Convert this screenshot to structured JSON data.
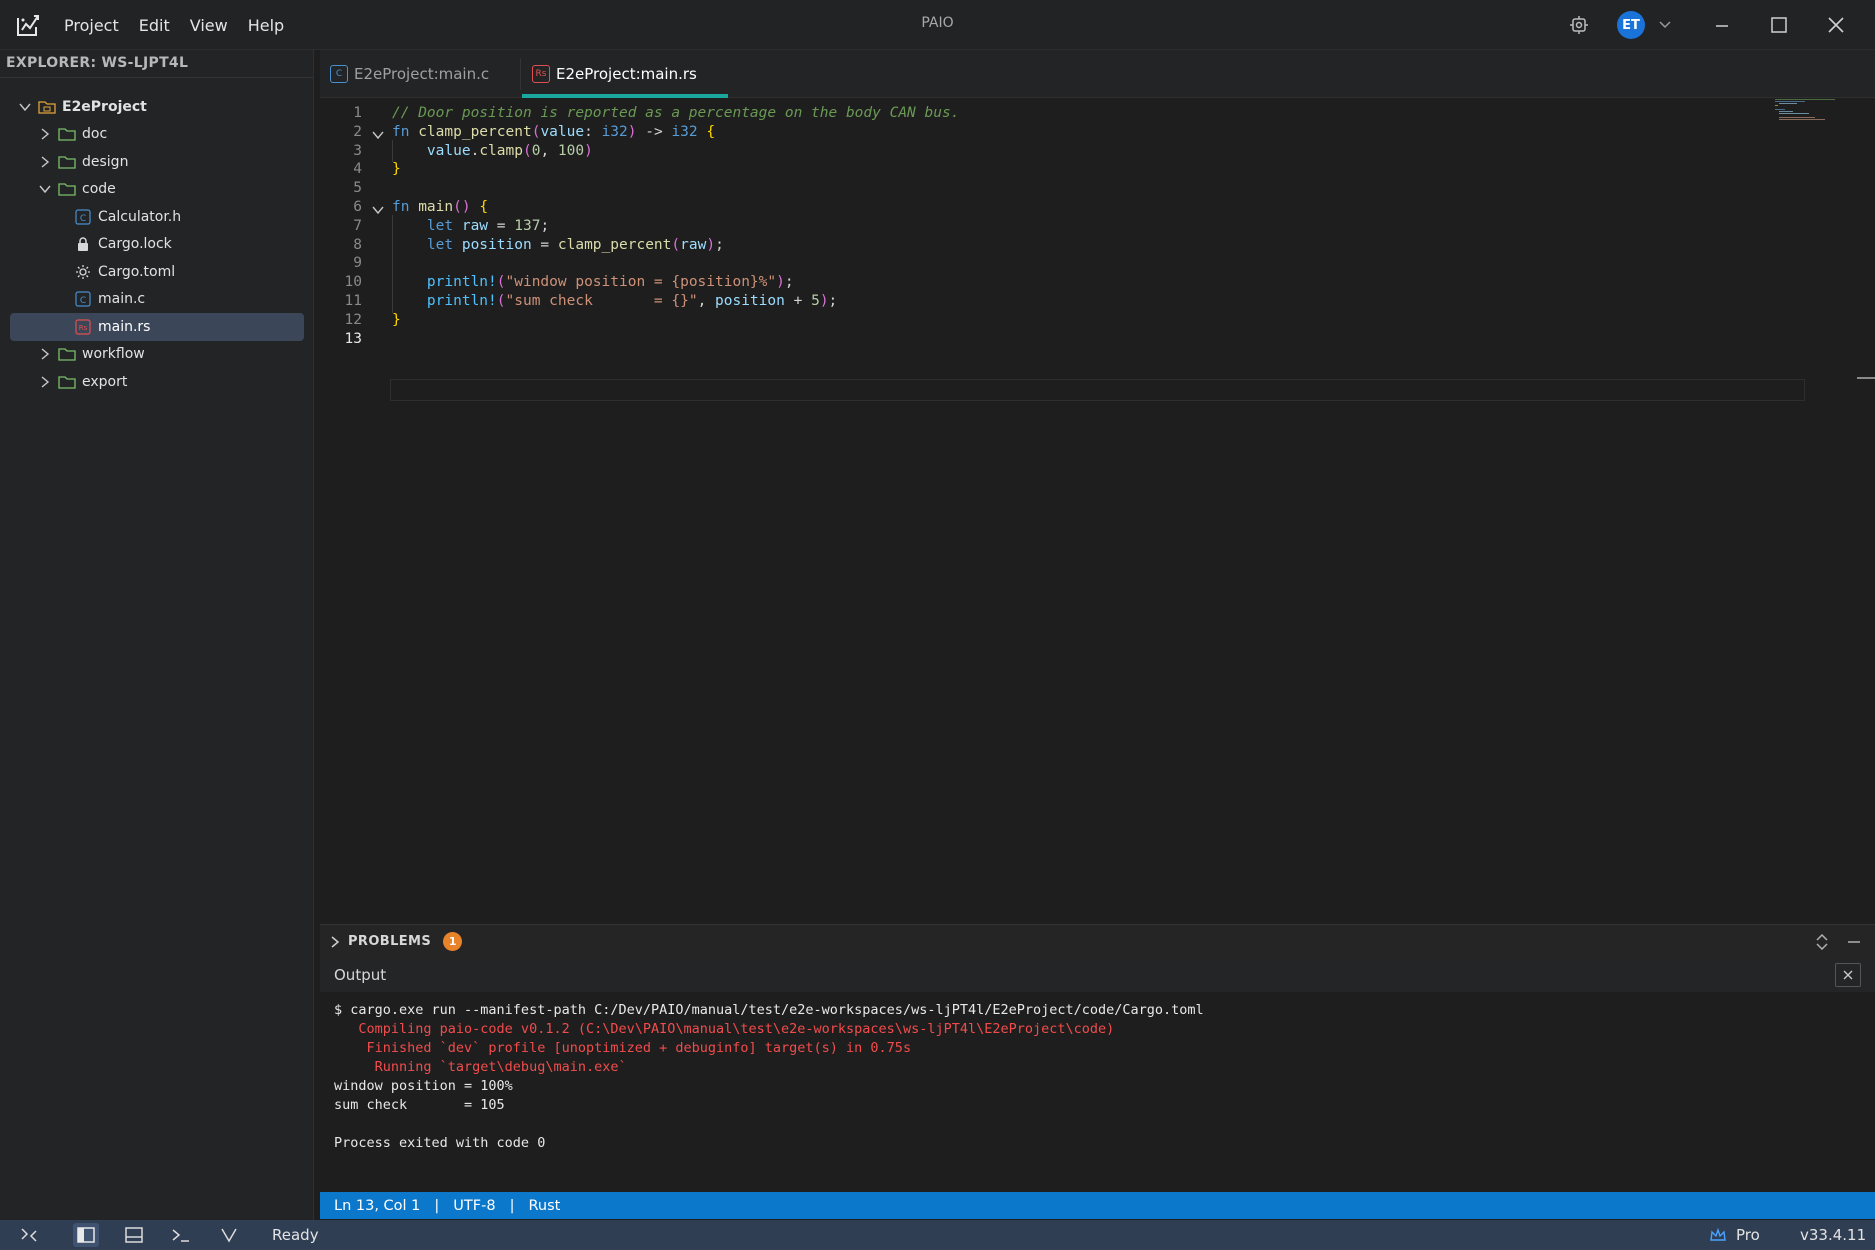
{
  "app": {
    "title": "PAIO",
    "menu": [
      "Project",
      "Edit",
      "View",
      "Help"
    ],
    "user_initials": "ET",
    "accent_color": "#1aa7a0",
    "avatar_color": "#1a73d9"
  },
  "sidebar": {
    "title": "EXPLORER: WS-LJPT4L",
    "tree": [
      {
        "label": "E2eProject",
        "type": "project",
        "expanded": true,
        "level": 0
      },
      {
        "label": "doc",
        "type": "folder",
        "expanded": false,
        "level": 1
      },
      {
        "label": "design",
        "type": "folder",
        "expanded": false,
        "level": 1
      },
      {
        "label": "code",
        "type": "folder",
        "expanded": true,
        "level": 1
      },
      {
        "label": "Calculator.h",
        "type": "c-file",
        "level": 2
      },
      {
        "label": "Cargo.lock",
        "type": "lock-file",
        "level": 2
      },
      {
        "label": "Cargo.toml",
        "type": "config-file",
        "level": 2
      },
      {
        "label": "main.c",
        "type": "c-file",
        "level": 2
      },
      {
        "label": "main.rs",
        "type": "rust-file",
        "level": 2,
        "selected": true
      },
      {
        "label": "workflow",
        "type": "folder",
        "expanded": false,
        "level": 1
      },
      {
        "label": "export",
        "type": "folder",
        "expanded": false,
        "level": 1
      }
    ]
  },
  "tabs": [
    {
      "label": "E2eProject:main.c",
      "icon": "c-file-icon",
      "active": false
    },
    {
      "label": "E2eProject:main.rs",
      "icon": "rust-file-icon",
      "active": true
    }
  ],
  "editor": {
    "line_numbers": [
      "1",
      "2",
      "3",
      "4",
      "5",
      "6",
      "7",
      "8",
      "9",
      "10",
      "11",
      "12",
      "13"
    ],
    "current_line": 13,
    "lines": [
      [
        {
          "t": "// Door position is reported as a percentage on the body CAN bus.",
          "c": "comment"
        }
      ],
      [
        {
          "t": "fn ",
          "c": "kw"
        },
        {
          "t": "clamp_percent",
          "c": "fn"
        },
        {
          "t": "(",
          "c": "paren"
        },
        {
          "t": "value",
          "c": "var"
        },
        {
          "t": ": ",
          "c": "plain"
        },
        {
          "t": "i32",
          "c": "kw"
        },
        {
          "t": ") ",
          "c": "paren"
        },
        {
          "t": "-> ",
          "c": "plain"
        },
        {
          "t": "i32",
          "c": "kw"
        },
        {
          "t": " {",
          "c": "brace"
        }
      ],
      [
        {
          "t": "    value",
          "c": "var"
        },
        {
          "t": ".",
          "c": "plain"
        },
        {
          "t": "clamp",
          "c": "fn"
        },
        {
          "t": "(",
          "c": "paren"
        },
        {
          "t": "0",
          "c": "num"
        },
        {
          "t": ", ",
          "c": "plain"
        },
        {
          "t": "100",
          "c": "num"
        },
        {
          "t": ")",
          "c": "paren"
        }
      ],
      [
        {
          "t": "}",
          "c": "brace"
        }
      ],
      [],
      [
        {
          "t": "fn ",
          "c": "kw"
        },
        {
          "t": "main",
          "c": "fn"
        },
        {
          "t": "() ",
          "c": "paren"
        },
        {
          "t": "{",
          "c": "brace"
        }
      ],
      [
        {
          "t": "    let ",
          "c": "kw"
        },
        {
          "t": "raw",
          "c": "var"
        },
        {
          "t": " = ",
          "c": "plain"
        },
        {
          "t": "137",
          "c": "num"
        },
        {
          "t": ";",
          "c": "plain"
        }
      ],
      [
        {
          "t": "    let ",
          "c": "kw"
        },
        {
          "t": "position",
          "c": "var"
        },
        {
          "t": " = ",
          "c": "plain"
        },
        {
          "t": "clamp_percent",
          "c": "fn"
        },
        {
          "t": "(",
          "c": "paren"
        },
        {
          "t": "raw",
          "c": "var"
        },
        {
          "t": ")",
          "c": "paren"
        },
        {
          "t": ";",
          "c": "plain"
        }
      ],
      [],
      [
        {
          "t": "    println!",
          "c": "macro"
        },
        {
          "t": "(",
          "c": "paren"
        },
        {
          "t": "\"window position = {position}%\"",
          "c": "str"
        },
        {
          "t": ")",
          "c": "paren"
        },
        {
          "t": ";",
          "c": "plain"
        }
      ],
      [
        {
          "t": "    println!",
          "c": "macro"
        },
        {
          "t": "(",
          "c": "paren"
        },
        {
          "t": "\"sum check       = {}\"",
          "c": "str"
        },
        {
          "t": ", ",
          "c": "plain"
        },
        {
          "t": "position",
          "c": "var"
        },
        {
          "t": " + ",
          "c": "plain"
        },
        {
          "t": "5",
          "c": "num"
        },
        {
          "t": ")",
          "c": "paren"
        },
        {
          "t": ";",
          "c": "plain"
        }
      ],
      [
        {
          "t": "}",
          "c": "brace"
        }
      ],
      []
    ]
  },
  "problems": {
    "label": "PROBLEMS",
    "count": "1"
  },
  "output": {
    "title": "Output",
    "lines": [
      {
        "text": "$ cargo.exe run --manifest-path C:/Dev/PAIO/manual/test/e2e-workspaces/ws-ljPT4l/E2eProject/code/Cargo.toml",
        "kind": "cmd"
      },
      {
        "text": "   Compiling paio-code v0.1.2 (C:\\Dev\\PAIO\\manual\\test\\e2e-workspaces\\ws-ljPT4l\\E2eProject\\code)",
        "kind": "err"
      },
      {
        "text": "    Finished `dev` profile [unoptimized + debuginfo] target(s) in 0.75s",
        "kind": "err"
      },
      {
        "text": "     Running `target\\debug\\main.exe`",
        "kind": "err"
      },
      {
        "text": "window position = 100%",
        "kind": "cmd"
      },
      {
        "text": "sum check       = 105",
        "kind": "cmd"
      },
      {
        "text": "",
        "kind": "cmd"
      },
      {
        "text": "Process exited with code 0",
        "kind": "cmd"
      }
    ]
  },
  "infobar": {
    "position": "Ln 13, Col 1",
    "encoding": "UTF-8",
    "language": "Rust",
    "separator": "|"
  },
  "statusbar": {
    "status": "Ready",
    "plan": "Pro",
    "version": "v33.4.11"
  }
}
